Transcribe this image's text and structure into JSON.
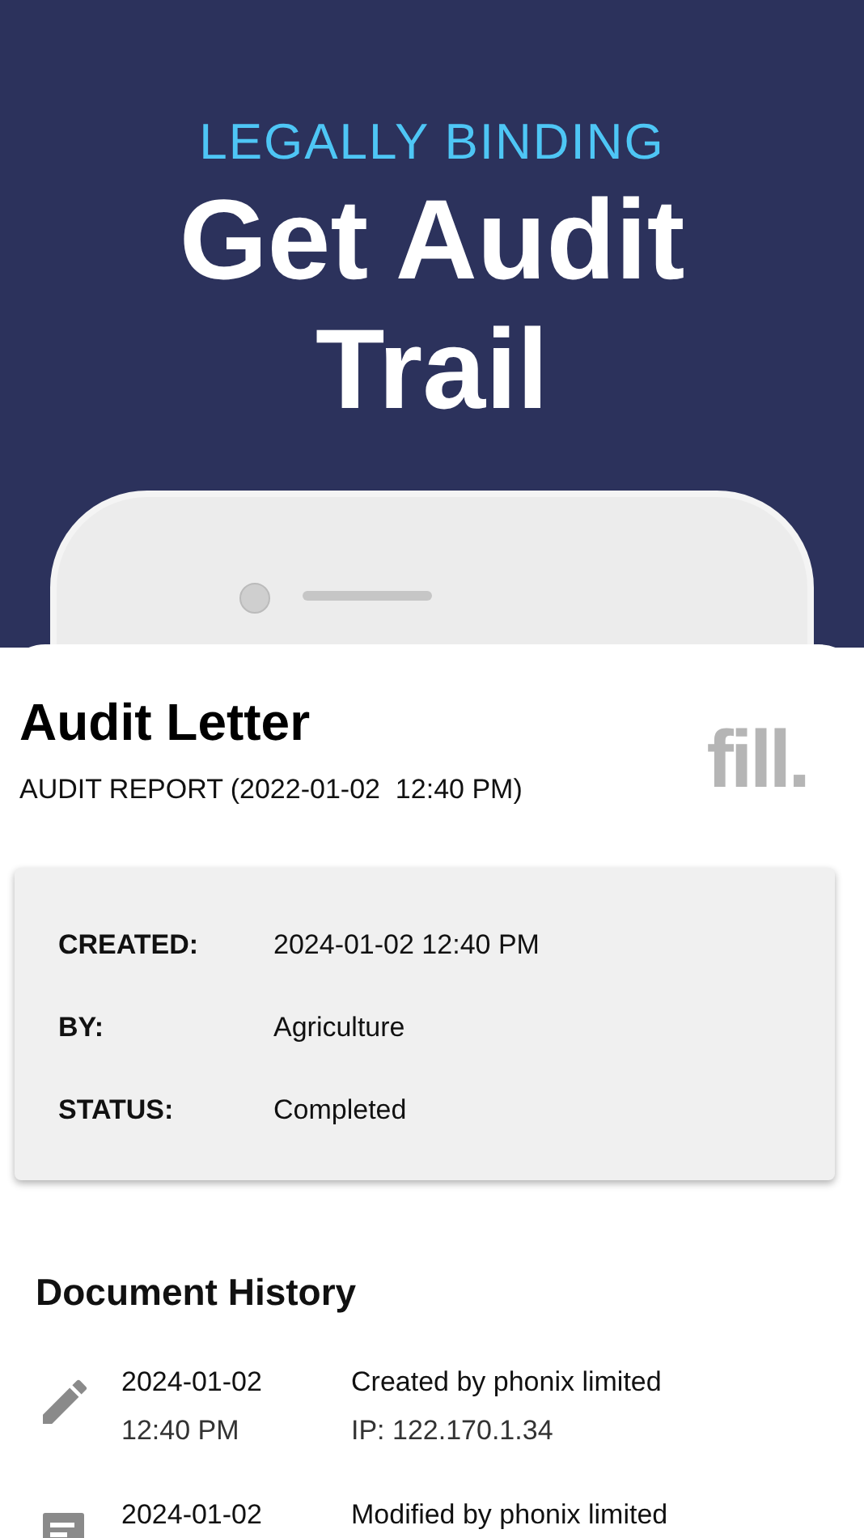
{
  "hero": {
    "eyebrow": "LEGALLY BINDING",
    "title_lines": [
      "Get Audit",
      "Trail"
    ]
  },
  "document": {
    "title": "Audit Letter",
    "subtitle": "AUDIT REPORT (2022-01-02  12:40 PM)",
    "logo": "fill."
  },
  "details": [
    {
      "label": "CREATED:",
      "value": "2024-01-02 12:40 PM"
    },
    {
      "label": "BY:",
      "value": "Agriculture"
    },
    {
      "label": "STATUS:",
      "value": "Completed"
    }
  ],
  "history": {
    "title": "Document History",
    "entries": [
      {
        "kind": "created",
        "date": "2024-01-02",
        "time": "12:40 PM",
        "action": "Created by phonix limited",
        "ip": "IP: 122.170.1.34"
      },
      {
        "kind": "modified",
        "date": "2024-01-02",
        "action": "Modified by phonix limited"
      }
    ]
  }
}
